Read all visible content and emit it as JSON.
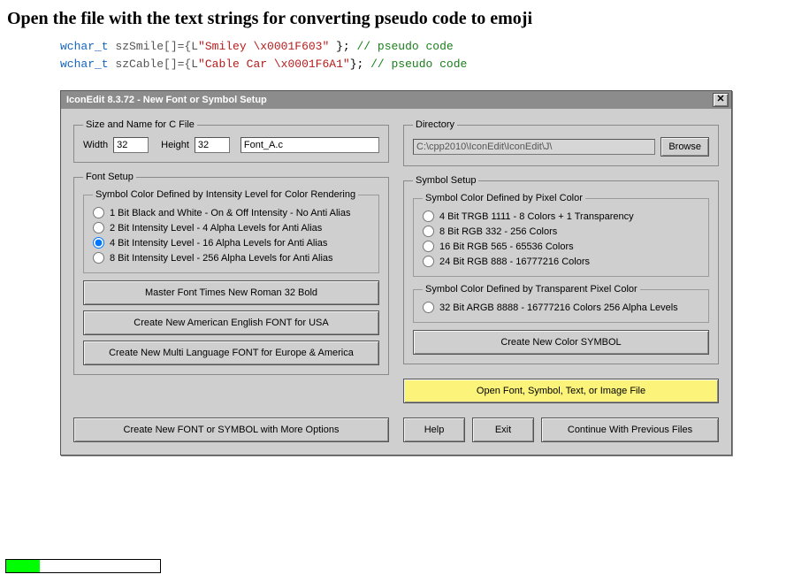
{
  "page": {
    "heading": "Open the file with the text strings for converting pseudo code to emoji"
  },
  "code": {
    "line1": {
      "kw": "wchar_t",
      "ident": "szSmile[]={L",
      "str": "\"Smiley \\x0001F603\" ",
      "punc": "};",
      "comm": " // pseudo code"
    },
    "line2": {
      "kw": "wchar_t",
      "ident": "szCable[]={L",
      "str": "\"Cable Car \\x0001F6A1\"",
      "punc": "};",
      "comm": " // pseudo code"
    }
  },
  "dialog": {
    "title": "IconEdit 8.3.72 - New Font or Symbol Setup",
    "sizeGroup": {
      "legend": "Size and Name for C File",
      "width_label": "Width",
      "width_value": "32",
      "height_label": "Height",
      "height_value": "32",
      "file_value": "Font_A.c"
    },
    "fontSetup": {
      "legend": "Font Setup",
      "intensityLegend": "Symbol Color Defined by Intensity Level for Color Rendering",
      "options": [
        "1 Bit Black and White - On & Off Intensity - No Anti Alias",
        "2 Bit Intensity Level - 4 Alpha Levels for Anti Alias",
        "4 Bit Intensity Level - 16 Alpha Levels for Anti Alias",
        "8 Bit Intensity Level - 256 Alpha Levels for Anti Alias"
      ],
      "selected": 2,
      "btn_master": "Master Font  Times New Roman 32 Bold",
      "btn_us": "Create New American English FONT for USA",
      "btn_eu": "Create New Multi Language FONT for Europe & America"
    },
    "dirGroup": {
      "legend": "Directory",
      "path": "C:\\cpp2010\\IconEdit\\IconEdit\\J\\",
      "browse": "Browse"
    },
    "symbolSetup": {
      "legend": "Symbol Setup",
      "pixelLegend": "Symbol Color Defined by Pixel Color",
      "pixelOptions": [
        "4 Bit TRGB 1111 - 8 Colors + 1 Transparency",
        "8 Bit RGB 332 - 256 Colors",
        "16 Bit RGB 565 - 65536 Colors",
        "24 Bit RGB 888 - 16777216 Colors"
      ],
      "transLegend": "Symbol Color Defined by Transparent Pixel Color",
      "transOption": "32 Bit ARGB 8888 - 16777216 Colors 256 Alpha Levels",
      "btn_newcolor": "Create New Color SYMBOL"
    },
    "openFile": "Open Font, Symbol, Text, or Image File",
    "bottom": {
      "more": "Create New FONT or SYMBOL with More Options",
      "help": "Help",
      "exit": "Exit",
      "cont": "Continue With Previous Files"
    }
  },
  "progress": {
    "percent": 22
  }
}
